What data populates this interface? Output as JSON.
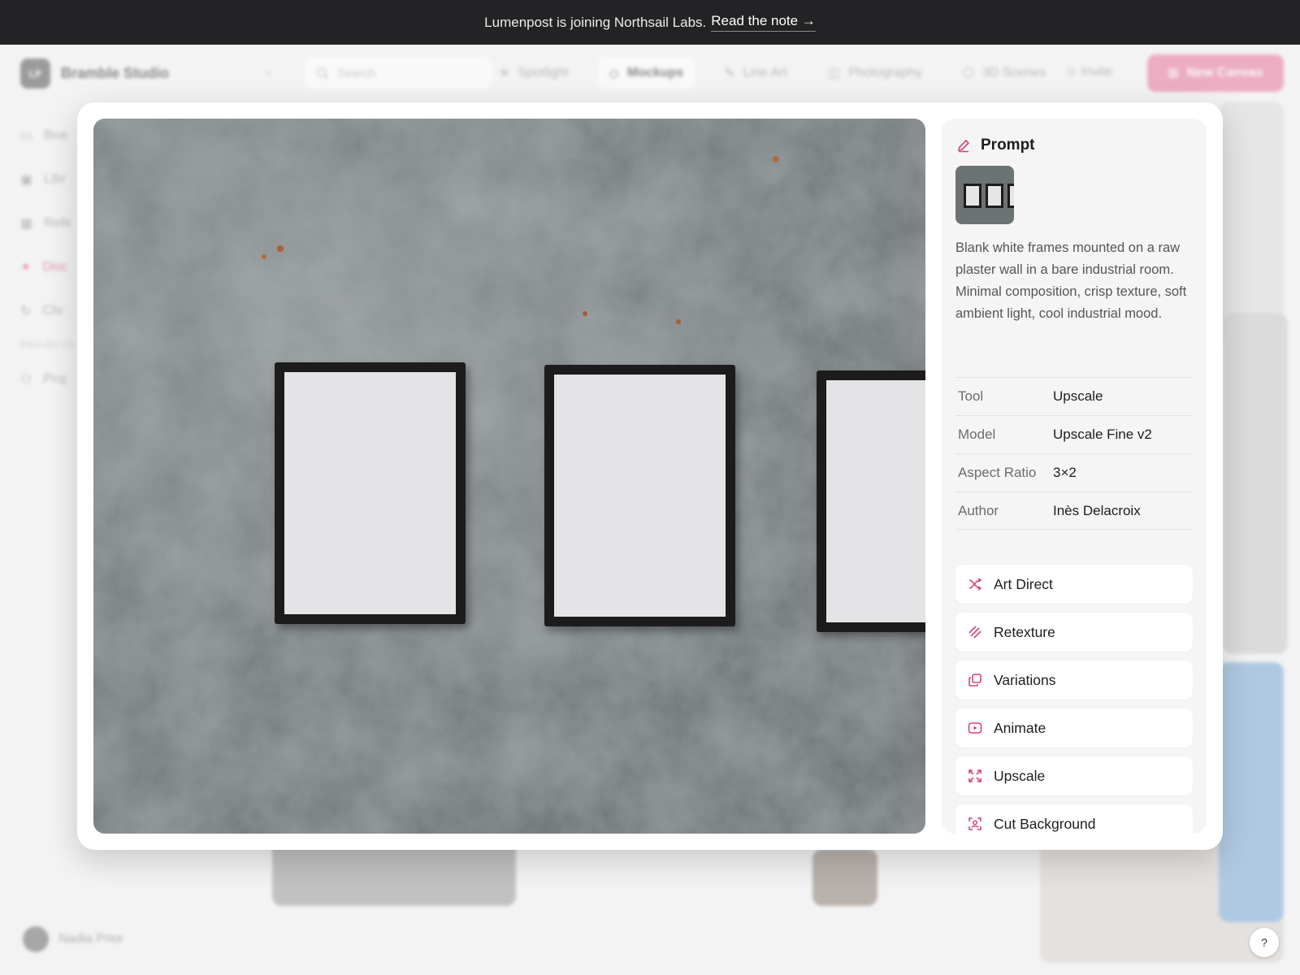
{
  "announcement": {
    "text": "Lumenpost is joining Northsail Labs.",
    "link": "Read the note →"
  },
  "workspace": {
    "initials": "LP",
    "name": "Bramble Studio"
  },
  "search": {
    "placeholder": "Search"
  },
  "nav_tabs": [
    {
      "label": "Spotlight",
      "icon": "spotlight-icon"
    },
    {
      "label": "Mockups",
      "icon": "gem-icon",
      "active": true
    },
    {
      "label": "Line Art",
      "icon": "pen-icon"
    },
    {
      "label": "Photography",
      "icon": "camera-icon"
    },
    {
      "label": "3D Scenes",
      "icon": "cube-icon"
    }
  ],
  "invite_label": "Invite",
  "new_canvas_label": "New Canvas",
  "sidebar": {
    "items": [
      "Boa",
      "Libr",
      "Refe",
      "Disc",
      "Chr"
    ],
    "section_label": "PROJECTS",
    "project_item": "Proj"
  },
  "user": {
    "name": "Nadia Prior"
  },
  "help_label": "?",
  "modal": {
    "prompt_title": "Prompt",
    "prompt_text": "Blank white frames mounted on a raw plaster wall in a bare industrial room. Minimal composition, crisp texture, soft ambient light, cool industrial mood.",
    "meta": [
      {
        "key": "Tool",
        "value": "Upscale"
      },
      {
        "key": "Model",
        "value": "Upscale Fine v2"
      },
      {
        "key": "Aspect Ratio",
        "value": "3×2"
      },
      {
        "key": "Author",
        "value": "Inès Delacroix"
      }
    ],
    "actions": [
      {
        "label": "Art Direct",
        "icon": "shuffle-icon"
      },
      {
        "label": "Retexture",
        "icon": "hatch-icon"
      },
      {
        "label": "Variations",
        "icon": "copy-icon"
      },
      {
        "label": "Animate",
        "icon": "play-icon"
      },
      {
        "label": "Upscale",
        "icon": "expand-icon"
      },
      {
        "label": "Cut Background",
        "icon": "cutout-icon"
      }
    ]
  },
  "colors": {
    "accent": "#d6456f",
    "announce_bg": "#232325",
    "new_canvas_bg": "#e8739a"
  }
}
